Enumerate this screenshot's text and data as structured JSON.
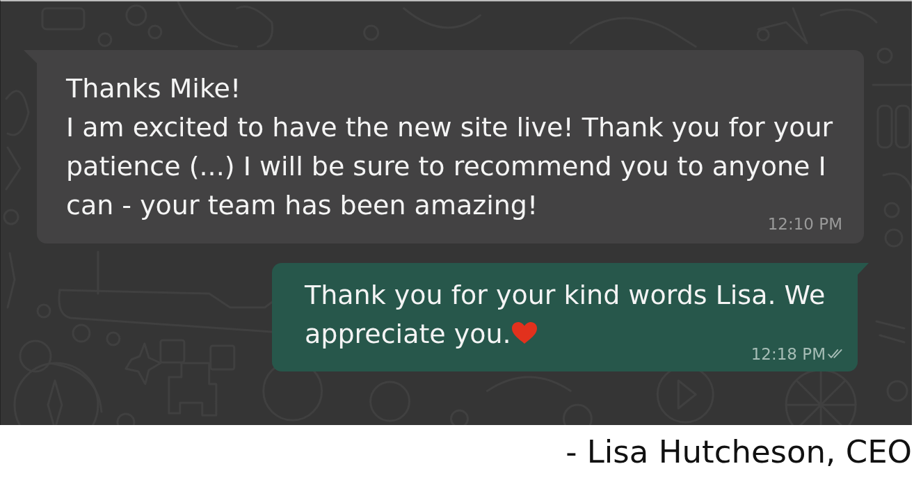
{
  "chat": {
    "messages": [
      {
        "kind": "incoming",
        "text": "Thanks Mike!\nI am excited to have the new site live! Thank you for your patience (...) I will be sure to recommend you to anyone I can - your team has been amazing!",
        "heart_emoji": false,
        "time": "12:10 PM"
      },
      {
        "kind": "outgoing",
        "text": "Thank you for your kind words Lisa. We appreciate you.",
        "heart_emoji": true,
        "time": "12:18 PM",
        "delivered": true
      }
    ]
  },
  "attribution": "- Lisa Hutcheson, CEO"
}
